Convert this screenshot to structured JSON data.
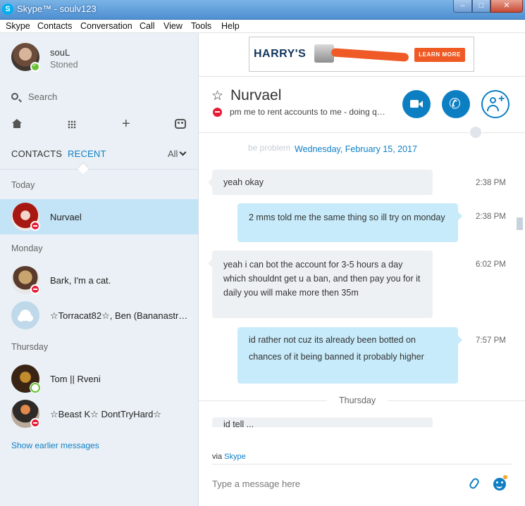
{
  "window": {
    "title": "Skype™ - soulv123",
    "min": "–",
    "max": "□",
    "close": "✕"
  },
  "menu": [
    "Skype",
    "Contacts",
    "Conversation",
    "Call",
    "View",
    "Tools",
    "Help"
  ],
  "profile": {
    "name": "souL",
    "mood": "Stoned",
    "status": "online"
  },
  "search": {
    "placeholder": "Search"
  },
  "tabs": {
    "contacts": "CONTACTS",
    "recent": "RECENT",
    "filter": "All"
  },
  "sections": {
    "today": "Today",
    "monday": "Monday",
    "thursday": "Thursday"
  },
  "contacts": [
    {
      "name": "Nurvael",
      "status": "dnd",
      "selected": true
    },
    {
      "name": "Bark, I'm a cat.",
      "status": "dnd"
    },
    {
      "name": "☆Torracat82☆, Ben (Bananastr…",
      "status": ""
    },
    {
      "name": "Tom || Rveni",
      "status": "away"
    },
    {
      "name": "☆Beast K☆ DontTryHard☆",
      "status": "dnd"
    }
  ],
  "show_earlier": "Show earlier messages",
  "ad": {
    "brand": "HARRY'S",
    "cta": "LEARN MORE"
  },
  "chat": {
    "title": "Nurvael",
    "mood": "pm me to rent accounts to me - doing q…",
    "date_banner": "Wednesday, February 15, 2017",
    "faded_text": "be problem",
    "day_divider": "Thursday",
    "partial_message": "id tell ... "
  },
  "messages": [
    {
      "direction": "in",
      "text": "yeah okay",
      "time": "2:38 PM"
    },
    {
      "direction": "out",
      "text": "2 mms told me the same thing so ill try on monday",
      "time": "2:38 PM"
    },
    {
      "direction": "in",
      "text": "yeah i can bot the account for 3-5 hours a day which shouldnt get u a ban, and then pay you for it daily you will make more then 35m",
      "time": "6:02 PM"
    },
    {
      "direction": "out",
      "text": "id rather not cuz its already been botted on chances of it being banned it probably higher",
      "time": "7:57 PM"
    }
  ],
  "composer": {
    "via_prefix": "via",
    "via_link": "Skype",
    "placeholder": "Type a message here"
  }
}
